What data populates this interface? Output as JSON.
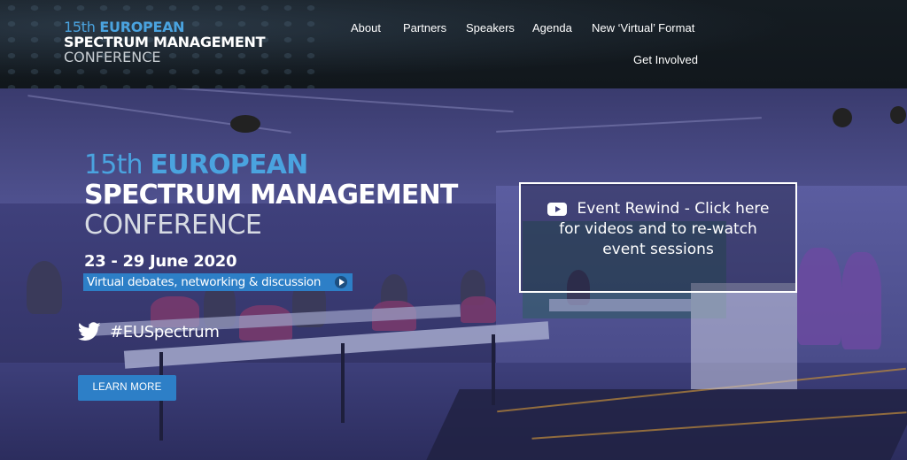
{
  "logo": {
    "line1_prefix": "15th",
    "line1_bold": "EUROPEAN",
    "line2": "SPECTRUM MANAGEMENT",
    "line3": "CONFERENCE"
  },
  "nav": {
    "items": [
      {
        "label": "About"
      },
      {
        "label": "Partners"
      },
      {
        "label": "Speakers"
      },
      {
        "label": "Agenda"
      },
      {
        "label": "New ‘Virtual’ Format"
      },
      {
        "label": "Get Involved"
      }
    ]
  },
  "hero": {
    "title_prefix": "15th",
    "title_bold": "EUROPEAN",
    "title_line2": "SPECTRUM MANAGEMENT",
    "title_line3": "CONFERENCE",
    "dates": "23 - 29 June 2020",
    "tagline": "Virtual debates, networking & discussion",
    "hashtag": "#EUSpectrum",
    "learn_more": "LEARN MORE"
  },
  "rewind": {
    "line1": "Event Rewind - Click here",
    "line2": "for videos and to re-watch",
    "line3": "event sessions"
  },
  "icons": {
    "twitter": "twitter-icon",
    "youtube": "youtube-icon",
    "play": "play-icon"
  },
  "colors": {
    "accent_blue": "#2d7fc7",
    "logo_blue": "#4aa3df",
    "header_bg": "#131a20",
    "hero_purple": "#45468a"
  }
}
